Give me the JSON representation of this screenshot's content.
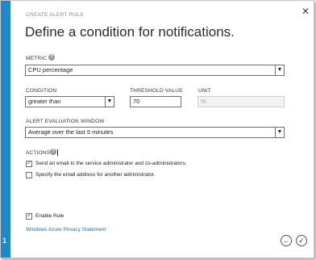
{
  "dialog": {
    "header": "CREATE ALERT RULE",
    "title": "Define a condition for notifications.",
    "step_number": "1"
  },
  "metric": {
    "label": "METRIC",
    "value": "CPU percentage"
  },
  "condition": {
    "label": "CONDITION",
    "value": "greater than"
  },
  "threshold": {
    "label": "THRESHOLD VALUE",
    "value": "70"
  },
  "unit": {
    "label": "UNIT",
    "value": "%"
  },
  "window": {
    "label": "ALERT EVALUATION WINDOW",
    "value": "Average over the last 5 minutes"
  },
  "actions": {
    "label": "ACTIONS",
    "items": [
      {
        "label": "Send an email to the service administrator and co-administrators.",
        "checked": true
      },
      {
        "label": "Specify the email address for another administrator.",
        "checked": false
      }
    ]
  },
  "enable_rule": {
    "label": "Enable Rule",
    "checked": true
  },
  "footer": {
    "privacy_link": "Windows Azure Privacy Statement"
  },
  "icons": {
    "close": "close-icon",
    "help": "help-icon",
    "back": "back-arrow-icon",
    "confirm": "checkmark-icon",
    "dropdown": "chevron-down-icon"
  },
  "colors": {
    "accent": "#1e89c9",
    "link": "#1e6fb5"
  }
}
